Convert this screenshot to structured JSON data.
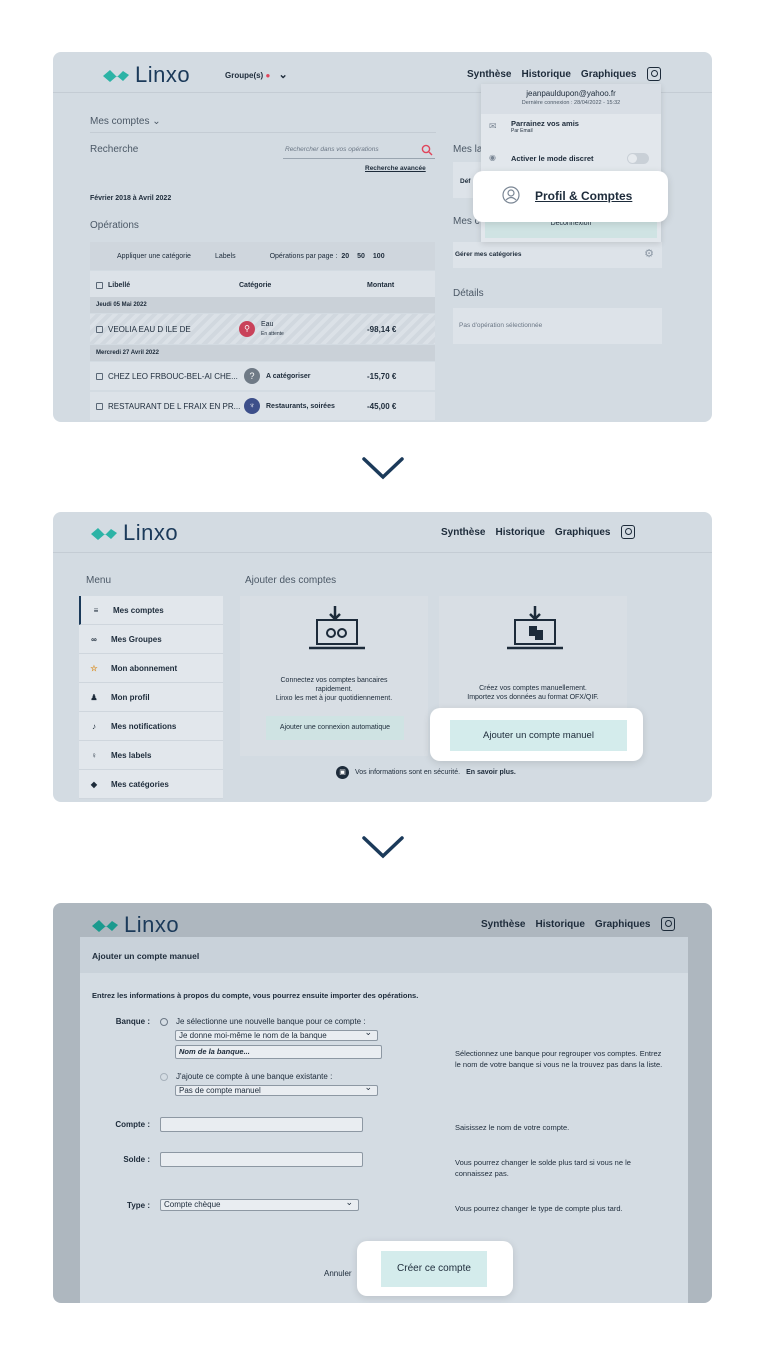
{
  "brand": {
    "name": "Linxo",
    "color": "#1b3a5a",
    "accent": "#2cb3a6"
  },
  "nav": {
    "synthese": "Synthèse",
    "historique": "Historique",
    "graphiques": "Graphiques",
    "profile_icon": "user-icon"
  },
  "step1": {
    "groups_label": "Groupe(s)",
    "section_title": "Mes comptes",
    "search_label": "Recherche",
    "search_placeholder": "Rechercher dans vos opérations",
    "advanced_search": "Recherche avancée",
    "period": "Février 2018 à Avril 2022",
    "operations_title": "Opérations",
    "toolbar": {
      "apply_category": "Appliquer une catégorie",
      "labels": "Labels",
      "per_page": "Opérations par page :",
      "pages": [
        "20",
        "50",
        "100"
      ]
    },
    "table_headers": {
      "label": "Libellé",
      "category": "Catégorie",
      "amount": "Montant"
    },
    "date1": "Jeudi 05 Mai 2022",
    "date2": "Mercredi 27 Avril 2022",
    "rows": [
      {
        "label": "VEOLIA EAU D ILE DE",
        "category": "Eau",
        "sub": "En attente",
        "amount": "-98,14 €"
      },
      {
        "label": "CHEZ LEO FRBOUC-BEL-AI CHE...",
        "category": "A catégoriser",
        "sub": "",
        "amount": "-15,70 €"
      },
      {
        "label": "RESTAURANT DE L FRAIX EN PR...",
        "category": "Restaurants, soirées",
        "sub": "",
        "amount": "-45,00 €"
      }
    ],
    "right": {
      "mes_labels": "Mes la",
      "def": "Déf",
      "mes_categories": "Mes c",
      "manage_categories": "Gérer mes catégories",
      "details": "Détails",
      "no_operation": "Pas d'opération sélectionnée"
    },
    "dropdown": {
      "email": "jeanpauldupon@yahoo.fr",
      "last_login": "Dernière connexion : 28/04/2022 - 15:32",
      "refer_title": "Parrainez vos amis",
      "refer_sub": "Par Email",
      "discreet": "Activer le mode discret",
      "profile": "Profil & Comptes",
      "logout": "Déconnexion"
    }
  },
  "step2": {
    "menu_title": "Menu",
    "menu": [
      "Mes comptes",
      "Mes Groupes",
      "Mon abonnement",
      "Mon profil",
      "Mes notifications",
      "Mes labels",
      "Mes catégories"
    ],
    "add_title": "Ajouter des comptes",
    "auto_text": [
      "Connectez vos comptes bancaires",
      "rapidement.",
      "Linxo les met à jour quotidiennement."
    ],
    "auto_button": "Ajouter une connexion automatique",
    "manual_text": [
      "Créez vos comptes manuellement.",
      "Importez vos données au format OFX/QIF."
    ],
    "manual_button": "Ajouter un compte manuel",
    "security_text": "Vos informations sont en sécurité.",
    "security_link": "En savoir plus."
  },
  "step3": {
    "title": "Ajouter un compte manuel",
    "intro": "Entrez les informations à propos du compte, vous pourrez ensuite importer des opérations.",
    "bank_label": "Banque :",
    "new_bank_option": "Je sélectionne une nouvelle banque pour ce compte :",
    "new_bank_select": "Je donne moi-même le nom de la banque",
    "bank_name_placeholder": "Nom de la banque...",
    "existing_bank_option": "J'ajoute ce compte à une banque existante :",
    "existing_bank_select": "Pas de compte manuel",
    "bank_help": [
      "Sélectionnez une banque pour regrouper vos comptes. Entrez",
      "le nom de votre banque si vous ne la trouvez pas dans la liste."
    ],
    "account_label": "Compte :",
    "account_help": "Saisissez le nom de votre compte.",
    "balance_label": "Solde :",
    "balance_help": [
      "Vous pourrez changer le solde plus tard si vous ne le",
      "connaissez pas."
    ],
    "type_label": "Type :",
    "type_select": "Compte chèque",
    "type_help": "Vous pourrez changer le type de compte plus tard.",
    "cancel": "Annuler",
    "create": "Créer ce compte"
  }
}
